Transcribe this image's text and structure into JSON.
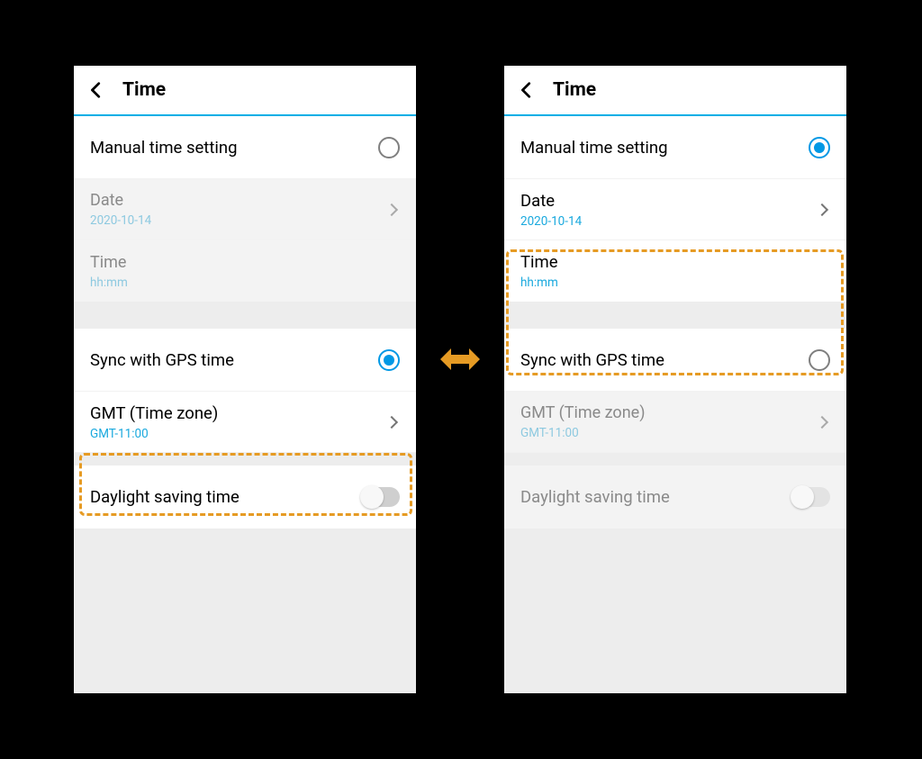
{
  "header": {
    "title": "Time"
  },
  "rows": {
    "manual": "Manual time setting",
    "date_label": "Date",
    "date_value": "2020-10-14",
    "time_label": "Time",
    "time_value": "hh:mm",
    "sync": "Sync with GPS time",
    "gmt_label": "GMT (Time zone)",
    "gmt_value": "GMT-11:00",
    "dst": "Daylight saving time"
  },
  "colors": {
    "accent": "#0098e5",
    "highlight": "#e69b24"
  }
}
